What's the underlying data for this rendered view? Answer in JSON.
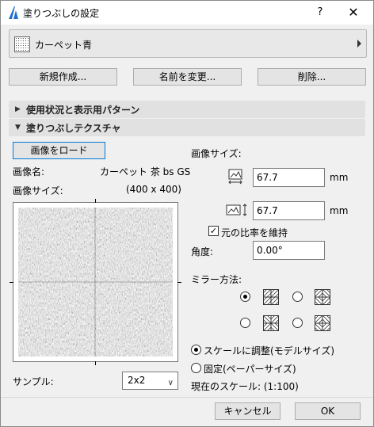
{
  "window": {
    "title": "塗りつぶしの設定",
    "help": "?",
    "close": "✕"
  },
  "fill_selector": {
    "name": "カーペット青"
  },
  "actions": {
    "new": "新規作成...",
    "rename": "名前を変更...",
    "delete": "削除..."
  },
  "sections": {
    "usage": "使用状況と表示用パターン",
    "texture": "塗りつぶしテクスチャ"
  },
  "texture": {
    "load_button": "画像をロード",
    "image_name_label": "画像名:",
    "image_name_value": "カーペット 茶 bs GS",
    "image_size_label": "画像サイズ:",
    "image_size_value": "(400 x 400)",
    "sample_label": "サンプル:",
    "sample_value": "2x2",
    "right_size_label": "画像サイズ:",
    "width_value": "67.7",
    "height_value": "67.7",
    "unit": "mm",
    "keep_ratio_label": "元の比率を維持",
    "keep_ratio_checked": true,
    "angle_label": "角度:",
    "angle_value": "0.00°",
    "mirror_label": "ミラー方法:",
    "mirror_selected": 0,
    "scale_fit_label": "スケールに調整(モデルサイズ)",
    "scale_fixed_label": "固定(ペーパーサイズ)",
    "current_scale_label": "現在のスケール: (1:100)",
    "scale_mode": "fit"
  },
  "footer": {
    "cancel": "キャンセル",
    "ok": "OK"
  },
  "colors": {
    "accent": "#0078d7",
    "section_bg": "#e1e1e1",
    "window_bg": "#f0f0f0"
  }
}
